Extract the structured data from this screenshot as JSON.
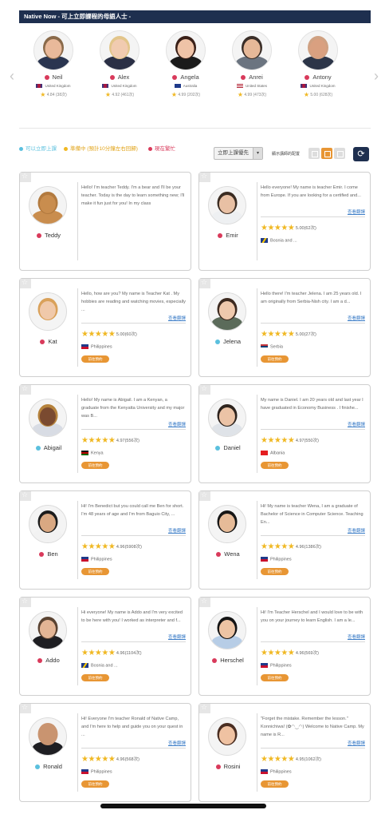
{
  "banner": {
    "title": "Native Now - 可上立即課程的母語人士 -"
  },
  "featured": [
    {
      "name": "Neil",
      "country": "United Kingdom",
      "rating": "4.84",
      "count": "(38次)",
      "flag": "uk",
      "hair": "#8a6a4a",
      "skin": "#e9b99a",
      "shirt": "#2a3550"
    },
    {
      "name": "Alex",
      "country": "United Kingdom",
      "rating": "4.92",
      "count": "(461次)",
      "flag": "uk",
      "hair": "#e2c58a",
      "skin": "#f1cbb0",
      "shirt": "#2a2f45"
    },
    {
      "name": "Angela",
      "country": "Australia",
      "rating": "4.99",
      "count": "(202次)",
      "flag": "au",
      "hair": "#3a2018",
      "skin": "#efc3a7",
      "shirt": "#1b1b1b"
    },
    {
      "name": "Anrei",
      "country": "United States",
      "rating": "4.99",
      "count": "(473次)",
      "flag": "us",
      "hair": "#3a2e28",
      "skin": "#e6b898",
      "shirt": "#6b7480"
    },
    {
      "name": "Antony",
      "country": "United Kingdom",
      "rating": "5.00",
      "count": "(628次)",
      "flag": "uk",
      "hair": "#cfa182",
      "skin": "#d9a080",
      "shirt": "#2c3548"
    }
  ],
  "legend": {
    "available": "可以立即上課",
    "teaching": "準備中 (預計10分鐘左右回歸)",
    "busy": "現在繁忙"
  },
  "controls": {
    "sort_value": "立即上課優先",
    "display_label": "顯示講師的配置"
  },
  "labels": {
    "more": "查看翻譯",
    "book": "前往預約"
  },
  "colors": {
    "navy": "#1e2f4f",
    "available": "#5bc0de",
    "teaching": "#f0b823",
    "busy": "#d93a5b",
    "accent": "#e89634",
    "link": "#3f7fc8"
  },
  "tutors": [
    {
      "name": "Teddy",
      "intro": "Hello! I'm teacher Teddy. I'm a bear and I'll be your teacher. Today is the day to learn something new; I'll make it fun just for you! In my class",
      "status": "red",
      "rating": "",
      "count": "",
      "country": "",
      "flag": "",
      "skin": "#c98d4e",
      "hair": "#b27a3f",
      "shirt": "#c98d4e"
    },
    {
      "name": "Emir",
      "intro": "Hello everyone! My name is teacher Emir. I come from Europe. If you are looking for a certified and...",
      "status": "red",
      "rating": "5.00",
      "count": "(62次)",
      "country": "Bosnia and ...",
      "flag": "ba",
      "skin": "#e8c0a4",
      "hair": "#3b2c22",
      "shirt": "#eef0f2"
    },
    {
      "name": "Kat",
      "intro": "Hello, how are you? My name is Teacher Kat . My hobbies are reading and watching movies, especially ...",
      "status": "red",
      "rating": "5.00",
      "count": "(60次)",
      "country": "Philippines",
      "flag": "ph",
      "skin": "#f0c9aa",
      "hair": "#d9a15a",
      "shirt": "#f4f4f4"
    },
    {
      "name": "Jelena",
      "intro": "Hello there! I'm teacher Jelena. I am 25 years old. I am originally from Serbia-Nish city. I am a d...",
      "status": "blue",
      "rating": "5.00",
      "count": "(27次)",
      "country": "Serbia",
      "flag": "rs",
      "skin": "#efc9ad",
      "hair": "#3d2a20",
      "shirt": "#5b6b5a"
    },
    {
      "name": "Abigail",
      "intro": "Hello! My name is Abigail. I am a Kenyan, a graduate from the Kenyatta University and my major was B...",
      "status": "blue",
      "rating": "4.97",
      "count": "(556次)",
      "country": "Kenya",
      "flag": "ke",
      "skin": "#7a4a30",
      "hair": "#b5823c",
      "shirt": "#d8dce4"
    },
    {
      "name": "Daniel",
      "intro": "My name is Daniel. I am 20 years old and last year I have graduated in Economy Business . I finishe...",
      "status": "blue",
      "rating": "4.97",
      "count": "(550次)",
      "country": "Albania",
      "flag": "al",
      "skin": "#ebc3a6",
      "hair": "#2e241e",
      "shirt": "#dfe3e8"
    },
    {
      "name": "Ben",
      "intro": "Hi! I'm Benedict but you could call me Ben for short. I'm 48 years of age and I'm from Baguio City, ...",
      "status": "red",
      "rating": "4.96",
      "count": "(5908次)",
      "country": "Philippines",
      "flag": "ph",
      "skin": "#d9a882",
      "hair": "#1c1c1c",
      "shirt": "#f2f2f2"
    },
    {
      "name": "Wena",
      "intro": "Hi! My name is teacher Wena, I am a graduate of Bachelor of Science in Computer Science. Teaching En...",
      "status": "red",
      "rating": "4.96",
      "count": "(1386次)",
      "country": "Philippines",
      "flag": "ph",
      "skin": "#e6bb98",
      "hair": "#161616",
      "shirt": "#f4f4f4"
    },
    {
      "name": "Addo",
      "intro": "Hi everyone! My name is Addo and I'm very excited to be here with you! I worked as interpreter and f...",
      "status": "red",
      "rating": "4.96",
      "count": "(1104次)",
      "country": "Bosnia and ...",
      "flag": "ba",
      "skin": "#e3b595",
      "hair": "#5a4332",
      "shirt": "#1e1e22"
    },
    {
      "name": "Herschel",
      "intro": "Hi! I'm Teacher Herschel and I would love to be with you on your journey to learn English. I am a le...",
      "status": "red",
      "rating": "4.96",
      "count": "(569次)",
      "country": "Philippines",
      "flag": "ph",
      "skin": "#edc4a4",
      "hair": "#141414",
      "shirt": "#b7cde6"
    },
    {
      "name": "Ronald",
      "intro": "Hi! Everyone I'm teacher Ronald of Native Camp, and I'm here to help and guide you on your quest in ...",
      "status": "blue",
      "rating": "4.96",
      "count": "(568次)",
      "country": "Philippines",
      "flag": "ph",
      "skin": "#c99470",
      "hair": "#c99470",
      "shirt": "#1e1e22"
    },
    {
      "name": "Rosini",
      "intro": "\"Forget the mistake. Remember the lesson.\" Konnichiwa! (✿◠‿◠) Welcome to Native Camp. My name is R...",
      "status": "red",
      "rating": "4.95",
      "count": "(1062次)",
      "country": "Philippines",
      "flag": "ph",
      "skin": "#efc2a2",
      "hair": "#4a2e22",
      "shirt": "#f4f4f4"
    }
  ]
}
